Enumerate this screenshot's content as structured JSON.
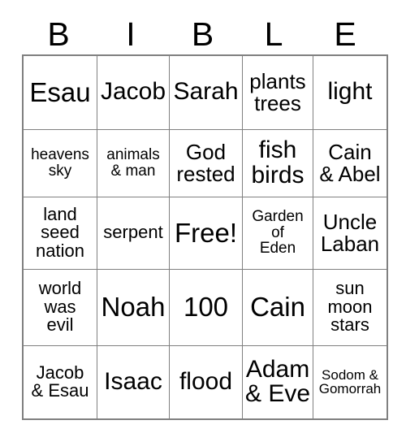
{
  "card": {
    "title_letters": [
      "B",
      "I",
      "B",
      "L",
      "E"
    ],
    "columns": 5,
    "rows": 5,
    "free_space": "Free!",
    "border_color": "#808080",
    "text_color": "#000000",
    "background_color": "#ffffff",
    "cells": [
      [
        {
          "text": "Esau",
          "size": "s-xl"
        },
        {
          "text": "Jacob",
          "size": "s-lg"
        },
        {
          "text": "Sarah",
          "size": "s-lg"
        },
        {
          "text": "plants\ntrees",
          "size": "s-md"
        },
        {
          "text": "light",
          "size": "s-lg"
        }
      ],
      [
        {
          "text": "heavens\nsky",
          "size": "s-xs"
        },
        {
          "text": "animals\n& man",
          "size": "s-xs"
        },
        {
          "text": "God\nrested",
          "size": "s-md"
        },
        {
          "text": "fish\nbirds",
          "size": "s-lg"
        },
        {
          "text": "Cain\n& Abel",
          "size": "s-md"
        }
      ],
      [
        {
          "text": "land\nseed\nnation",
          "size": "s-sm"
        },
        {
          "text": "serpent",
          "size": "s-sm"
        },
        {
          "text": "Free!",
          "size": "s-xl"
        },
        {
          "text": "Garden\nof\nEden",
          "size": "s-xs"
        },
        {
          "text": "Uncle\nLaban",
          "size": "s-md"
        }
      ],
      [
        {
          "text": "world\nwas\nevil",
          "size": "s-sm"
        },
        {
          "text": "Noah",
          "size": "s-xl"
        },
        {
          "text": "100",
          "size": "s-xl"
        },
        {
          "text": "Cain",
          "size": "s-xl"
        },
        {
          "text": "sun\nmoon\nstars",
          "size": "s-sm"
        }
      ],
      [
        {
          "text": "Jacob\n& Esau",
          "size": "s-sm"
        },
        {
          "text": "Isaac",
          "size": "s-lg"
        },
        {
          "text": "flood",
          "size": "s-lg"
        },
        {
          "text": "Adam\n& Eve",
          "size": "s-lg"
        },
        {
          "text": "Sodom &\nGomorrah",
          "size": "s-xxs"
        }
      ]
    ]
  }
}
